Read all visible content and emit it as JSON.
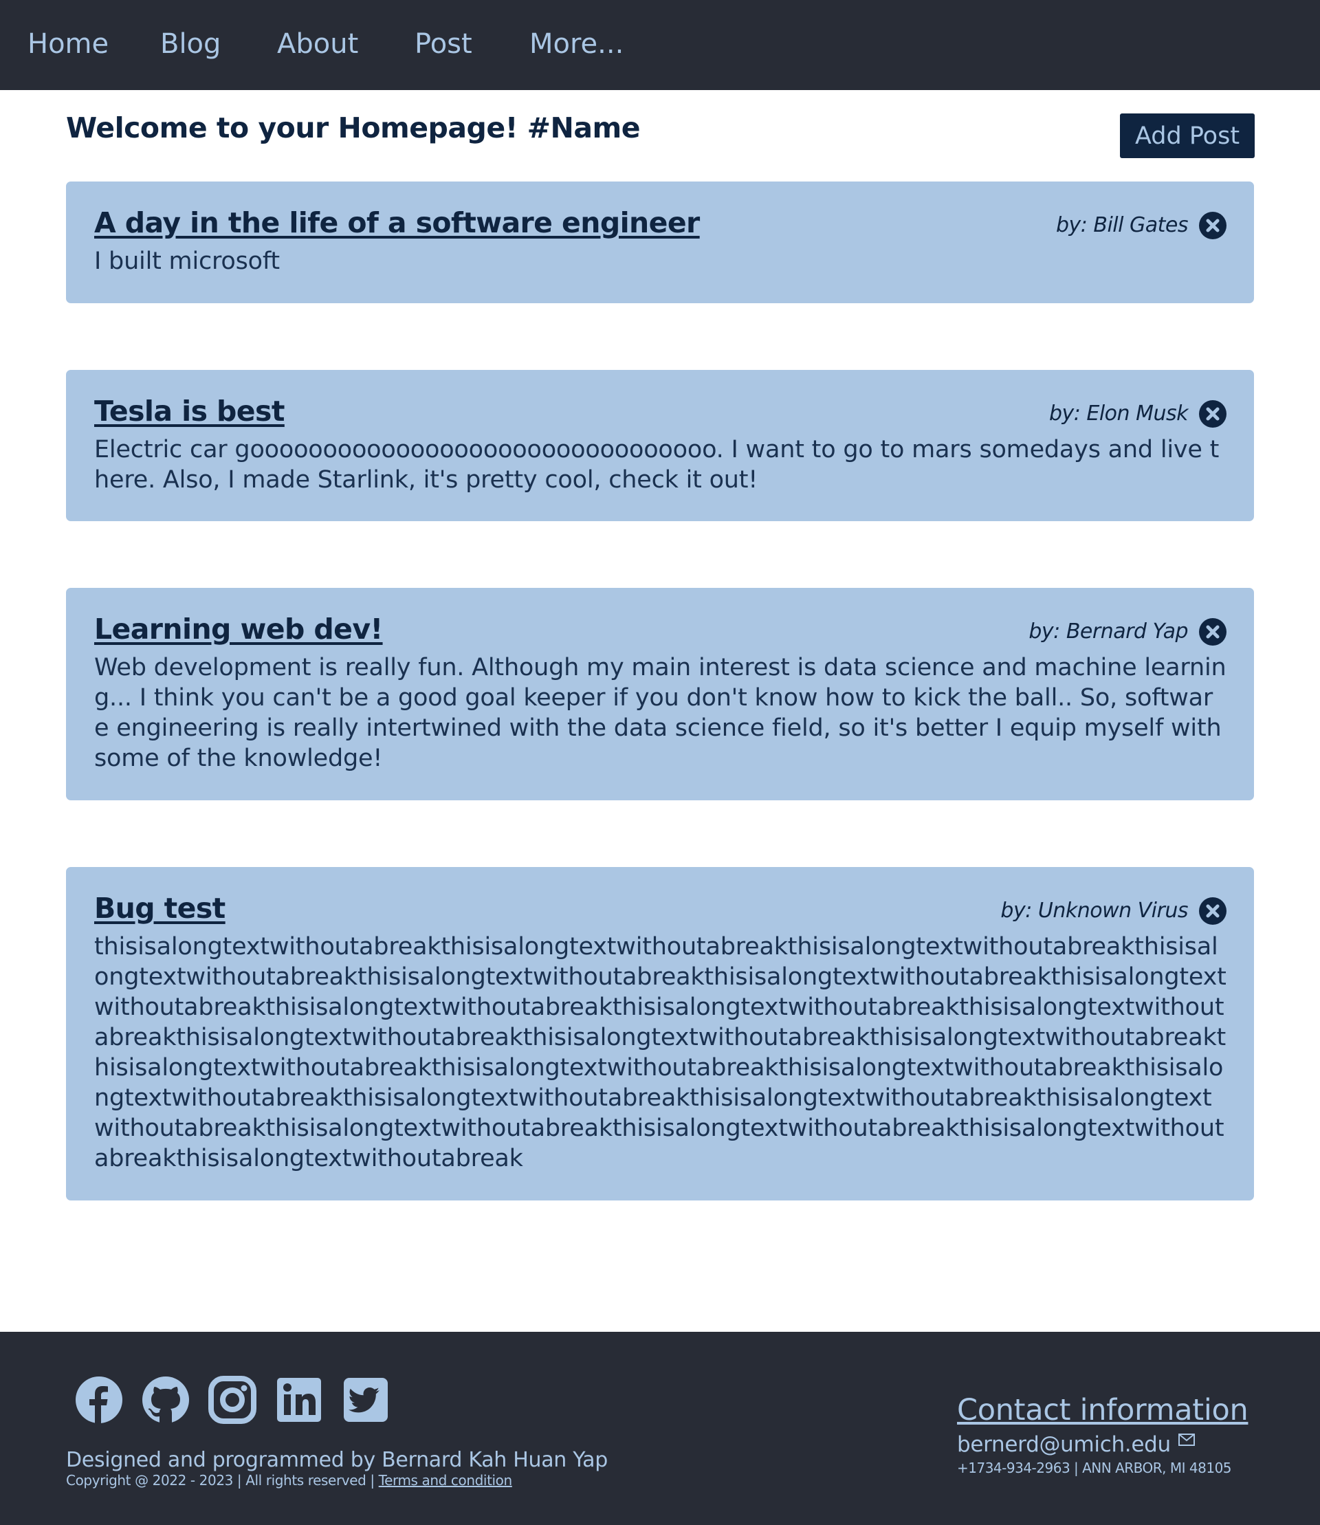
{
  "nav": {
    "items": [
      "Home",
      "Blog",
      "About",
      "Post",
      "More..."
    ]
  },
  "header": {
    "welcome": "Welcome to your Homepage! #Name",
    "add_post_label": "Add Post"
  },
  "posts": [
    {
      "title": "A day in the life of a software engineer",
      "author": "by: Bill Gates",
      "body": "I built microsoft"
    },
    {
      "title": "Tesla is best",
      "author": "by: Elon Musk",
      "body": "Electric car goooooooooooooooooooooooooooooooo. I want to go to mars somedays and live there. Also, I made Starlink, it's pretty cool, check it out!"
    },
    {
      "title": "Learning web dev!",
      "author": "by: Bernard Yap",
      "body": "Web development is really fun. Although my main interest is data science and machine learning... I think you can't be a good goal keeper if you don't know how to kick the ball.. So, software engineering is really intertwined with the data science field, so it's better I equip myself with some of the knowledge!"
    },
    {
      "title": "Bug test",
      "author": "by: Unknown Virus",
      "body": "thisisalongtextwithoutabreakthisisalongtextwithoutabreakthisisalongtextwithoutabreakthisisalongtextwithoutabreakthisisalongtextwithoutabreakthisisalongtextwithoutabreakthisisalongtextwithoutabreakthisisalongtextwithoutabreakthisisalongtextwithoutabreakthisisalongtextwithoutabreakthisisalongtextwithoutabreakthisisalongtextwithoutabreakthisisalongtextwithoutabreakthisisalongtextwithoutabreakthisisalongtextwithoutabreakthisisalongtextwithoutabreakthisisalongtextwithoutabreakthisisalongtextwithoutabreakthisisalongtextwithoutabreakthisisalongtextwithoutabreakthisisalongtextwithoutabreakthisisalongtextwithoutabreakthisisalongtextwithoutabreakthisisalongtextwithoutabreak"
    }
  ],
  "footer": {
    "social_icons": [
      "facebook-icon",
      "github-icon",
      "instagram-icon",
      "linkedin-icon",
      "twitter-icon"
    ],
    "designed_by": "Designed and programmed by Bernard Kah Huan Yap",
    "copyright": "Copyright @ 2022 - 2023 | All rights reserved | ",
    "terms_link": "Terms and condition",
    "contact_title": "Contact information",
    "email": "bernerd@umich.edu",
    "phone_address": "+1734-934-2963 | ANN ARBOR, MI 48105"
  },
  "colors": {
    "nav_bg": "#282c36",
    "nav_text": "#aac6e4",
    "card_bg": "#abc6e3",
    "dark_navy": "#0f2440"
  }
}
